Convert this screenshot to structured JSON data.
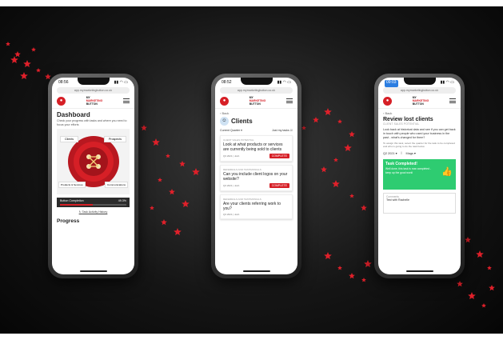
{
  "phones": {
    "left": {
      "time": "08:56",
      "url": "app.mymarketingbutton.co.uk",
      "brand": {
        "line1": "MY",
        "line2": "MARKETING",
        "line3": "BUTTON"
      },
      "title": "Dashboard",
      "subtitle": "Check your progress with tasks and where you need to focus your efforts",
      "segments": [
        "Clients",
        "Prospects",
        "Products & Services",
        "Communications"
      ],
      "completion_label": "Button Completion",
      "completion_value": "49.3%",
      "completion_fraction": 0.493,
      "link": "Task Activity History",
      "section": "Progress"
    },
    "middle": {
      "time": "08:52",
      "url": "app.mymarketingbutton.co.uk",
      "brand": {
        "line1": "MY",
        "line2": "MARKETING",
        "line3": "BUTTON"
      },
      "back": "Back",
      "title": "Clients",
      "filter": "Current Quarter",
      "toggle": "Just my tasks",
      "cards": [
        {
          "tag": "CLIENT SALES POTENTIAL",
          "title": "Look at what products or services are currently being sold to clients",
          "meta": "Q3 2021 | Josh",
          "badge": "COMPLETE"
        },
        {
          "tag": "REFERRALS AND TESTIMONIALS",
          "title": "Can you include client logos on your website?",
          "meta": "Q3 2021 | Josh",
          "badge": "COMPLETE"
        },
        {
          "tag": "REFERRALS AND TESTIMONIALS",
          "title": "Are your clients referring work to you?",
          "meta": "Q3 2021 | Josh",
          "badge": ""
        }
      ]
    },
    "right": {
      "time": "09:03",
      "url": "app.mymarketingbutton.co.uk",
      "brand": {
        "line1": "MY",
        "line2": "MARKETING",
        "line3": "BUTTON"
      },
      "back": "Back",
      "title": "Review lost clients",
      "tag": "CLIENT SALES POTENTIAL",
      "body": "Look back at historical data and see if you can get back in touch with people who used your business in the past - what's changed for them?",
      "instruction": "To assign this task, select the quarter for the task to be completed and who is going to do the task below.",
      "quarter": "Q2 2021",
      "assignee": "Mags",
      "done_title": "Task Completed!",
      "done_text": "Well done, this task is now completed - keep up the good work!",
      "comments_label": "Comments",
      "comment": "Test with Rachelle"
    }
  },
  "colors": {
    "brand_red": "#d61f26",
    "success_green": "#2ecc71",
    "background": "#111111"
  }
}
